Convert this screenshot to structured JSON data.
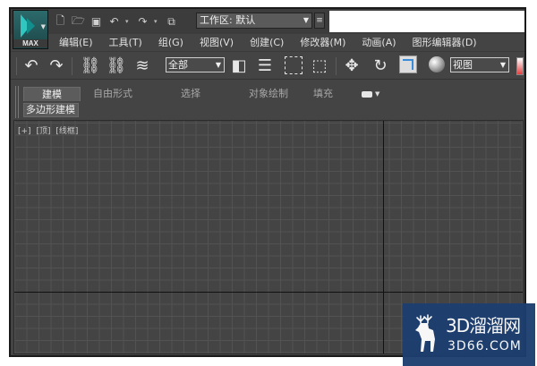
{
  "app": {
    "logo_text": "MAX"
  },
  "quick_access": {
    "workspace_label": "工作区: 默认"
  },
  "menu": {
    "items": [
      "编辑(E)",
      "工具(T)",
      "组(G)",
      "视图(V)",
      "创建(C)",
      "修改器(M)",
      "动画(A)",
      "图形编辑器(D)"
    ]
  },
  "toolbar": {
    "selection_filter": "全部",
    "reference_coord": "视图"
  },
  "ribbon": {
    "tabs": [
      "建模",
      "自由形式",
      "选择",
      "对象绘制",
      "填充"
    ],
    "active_tab": "建模",
    "panel_label": "多边形建模"
  },
  "viewport": {
    "label_plus": "[+]",
    "label_view": "[顶]",
    "label_shading": "[线框]"
  },
  "watermark": {
    "title": "3D溜溜网",
    "url": "3D66.COM"
  },
  "colors": {
    "ui_background": "#444444",
    "grid_line": "#525252",
    "logo_teal": "#2fc7c0",
    "watermark_blue": "#1d3f70"
  }
}
